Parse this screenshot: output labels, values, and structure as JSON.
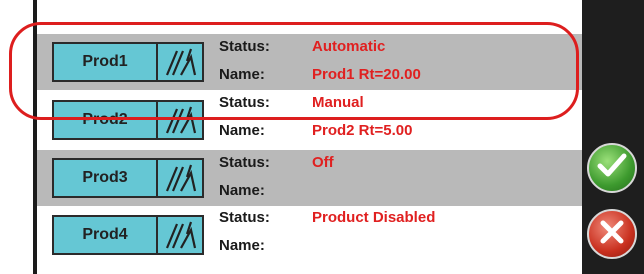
{
  "rows": [
    {
      "button_label": "Prod1",
      "status_label": "Status:",
      "status_value": "Automatic",
      "name_label": "Name:",
      "name_value": "Prod1 Rt=20.00"
    },
    {
      "button_label": "Prod2",
      "status_label": "Status:",
      "status_value": "Manual",
      "name_label": "Name:",
      "name_value": "Prod2 Rt=5.00"
    },
    {
      "button_label": "Prod3",
      "status_label": "Status:",
      "status_value": "Off",
      "name_label": "Name:",
      "name_value": ""
    },
    {
      "button_label": "Prod4",
      "status_label": "Status:",
      "status_value": "Product Disabled",
      "name_label": "Name:",
      "name_value": ""
    }
  ],
  "icons": {
    "product_icon": "spray-boom-icon",
    "ok": "checkmark-icon",
    "cancel": "close-x-icon"
  },
  "colors": {
    "button_fill": "#65c7d4",
    "value_text": "#e02020",
    "row_gray": "#b9b9b9",
    "highlight": "#dd1e1e",
    "ok": "#3d9a2e",
    "cancel": "#c9301f"
  }
}
